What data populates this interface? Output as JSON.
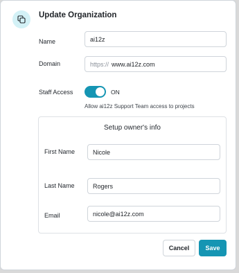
{
  "dialog": {
    "title": "Update Organization",
    "icon": "copy-icon"
  },
  "fields": {
    "name": {
      "label": "Name",
      "value": "ai12z"
    },
    "domain": {
      "label": "Domain",
      "prefix": "https://",
      "value": "www.ai12z.com"
    },
    "staff_access": {
      "label": "Staff Access",
      "state": "ON",
      "enabled": true,
      "helper": "Allow ai12z Support Team access to projects"
    }
  },
  "owner": {
    "section_title": "Setup owner's info",
    "first_name": {
      "label": "First Name",
      "value": "Nicole"
    },
    "last_name": {
      "label": "Last Name",
      "value": "Rogers"
    },
    "email": {
      "label": "Email",
      "value": "nicole@ai12z.com"
    }
  },
  "buttons": {
    "cancel": "Cancel",
    "save": "Save"
  },
  "colors": {
    "accent": "#1595b3",
    "icon_bg": "#d3f1f6"
  }
}
